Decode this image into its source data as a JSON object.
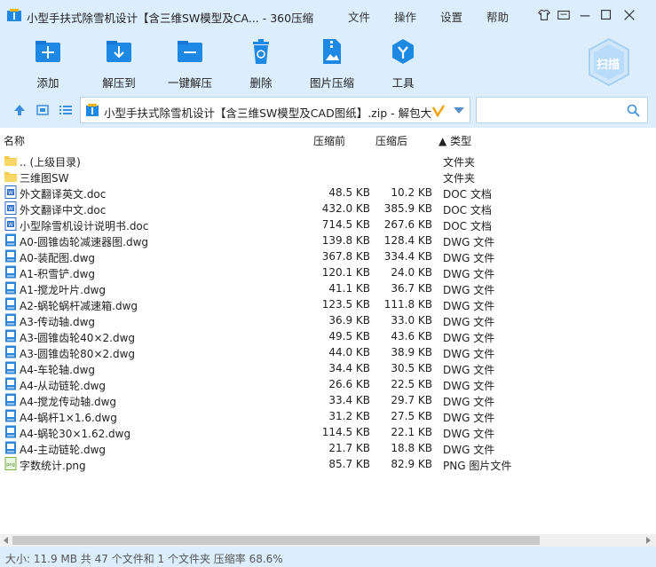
{
  "window": {
    "title": "小型手扶式除雪机设计【含三维SW模型及CA... - 360压缩",
    "menus": [
      "文件",
      "操作",
      "设置",
      "帮助"
    ]
  },
  "toolbar": {
    "items": [
      {
        "label": "添加",
        "icon": "add-icon"
      },
      {
        "label": "解压到",
        "icon": "extract-to-icon"
      },
      {
        "label": "一键解压",
        "icon": "one-click-extract-icon"
      },
      {
        "label": "删除",
        "icon": "trash-icon"
      },
      {
        "label": "图片压缩",
        "icon": "image-compress-icon"
      },
      {
        "label": "工具",
        "icon": "tools-icon"
      }
    ],
    "scan_label": "扫描"
  },
  "address": {
    "path": "小型手扶式除雪机设计【含三维SW模型及CAD图纸】.zip - 解包大小为"
  },
  "columns": {
    "name": "名称",
    "packed": "压缩前",
    "unpacked": "压缩后",
    "type": "▲ 类型"
  },
  "files": [
    {
      "name": ".. (上级目录)",
      "packed": "",
      "unpacked": "",
      "type": "文件夹",
      "kind": "folder"
    },
    {
      "name": "三维图SW",
      "packed": "",
      "unpacked": "",
      "type": "文件夹",
      "kind": "folder"
    },
    {
      "name": "外文翻译英文.doc",
      "packed": "48.5 KB",
      "unpacked": "10.2 KB",
      "type": "DOC 文档",
      "kind": "doc"
    },
    {
      "name": "外文翻译中文.doc",
      "packed": "432.0 KB",
      "unpacked": "385.9 KB",
      "type": "DOC 文档",
      "kind": "doc"
    },
    {
      "name": "小型除雪机设计说明书.doc",
      "packed": "714.5 KB",
      "unpacked": "267.6 KB",
      "type": "DOC 文档",
      "kind": "doc"
    },
    {
      "name": "A0-圆锥齿轮减速器图.dwg",
      "packed": "139.8 KB",
      "unpacked": "128.4 KB",
      "type": "DWG 文件",
      "kind": "dwg"
    },
    {
      "name": "A0-装配图.dwg",
      "packed": "367.8 KB",
      "unpacked": "334.4 KB",
      "type": "DWG 文件",
      "kind": "dwg"
    },
    {
      "name": "A1-积雪铲.dwg",
      "packed": "120.1 KB",
      "unpacked": "24.0 KB",
      "type": "DWG 文件",
      "kind": "dwg"
    },
    {
      "name": "A1-搅龙叶片.dwg",
      "packed": "41.1 KB",
      "unpacked": "36.7 KB",
      "type": "DWG 文件",
      "kind": "dwg"
    },
    {
      "name": "A2-蜗轮蜗杆减速箱.dwg",
      "packed": "123.5 KB",
      "unpacked": "111.8 KB",
      "type": "DWG 文件",
      "kind": "dwg"
    },
    {
      "name": "A3-传动轴.dwg",
      "packed": "36.9 KB",
      "unpacked": "33.0 KB",
      "type": "DWG 文件",
      "kind": "dwg"
    },
    {
      "name": "A3-圆锥齿轮40×2.dwg",
      "packed": "49.5 KB",
      "unpacked": "43.6 KB",
      "type": "DWG 文件",
      "kind": "dwg"
    },
    {
      "name": "A3-圆锥齿轮80×2.dwg",
      "packed": "44.0 KB",
      "unpacked": "38.9 KB",
      "type": "DWG 文件",
      "kind": "dwg"
    },
    {
      "name": "A4-车轮轴.dwg",
      "packed": "34.4 KB",
      "unpacked": "30.5 KB",
      "type": "DWG 文件",
      "kind": "dwg"
    },
    {
      "name": "A4-从动链轮.dwg",
      "packed": "26.6 KB",
      "unpacked": "22.5 KB",
      "type": "DWG 文件",
      "kind": "dwg"
    },
    {
      "name": "A4-搅龙传动轴.dwg",
      "packed": "33.4 KB",
      "unpacked": "29.7 KB",
      "type": "DWG 文件",
      "kind": "dwg"
    },
    {
      "name": "A4-蜗杆1×1.6.dwg",
      "packed": "31.2 KB",
      "unpacked": "27.5 KB",
      "type": "DWG 文件",
      "kind": "dwg"
    },
    {
      "name": "A4-蜗轮30×1.62.dwg",
      "packed": "114.5 KB",
      "unpacked": "22.1 KB",
      "type": "DWG 文件",
      "kind": "dwg"
    },
    {
      "name": "A4-主动链轮.dwg",
      "packed": "21.7 KB",
      "unpacked": "18.8 KB",
      "type": "DWG 文件",
      "kind": "dwg"
    },
    {
      "name": "字数统计.png",
      "packed": "85.7 KB",
      "unpacked": "82.9 KB",
      "type": "PNG 图片文件",
      "kind": "png"
    }
  ],
  "status": {
    "text": "大小: 11.9 MB 共 47 个文件和 1 个文件夹 压缩率 68.6%"
  },
  "colors": {
    "chrome_bg": "#dceefc",
    "accent": "#1e88e5"
  }
}
